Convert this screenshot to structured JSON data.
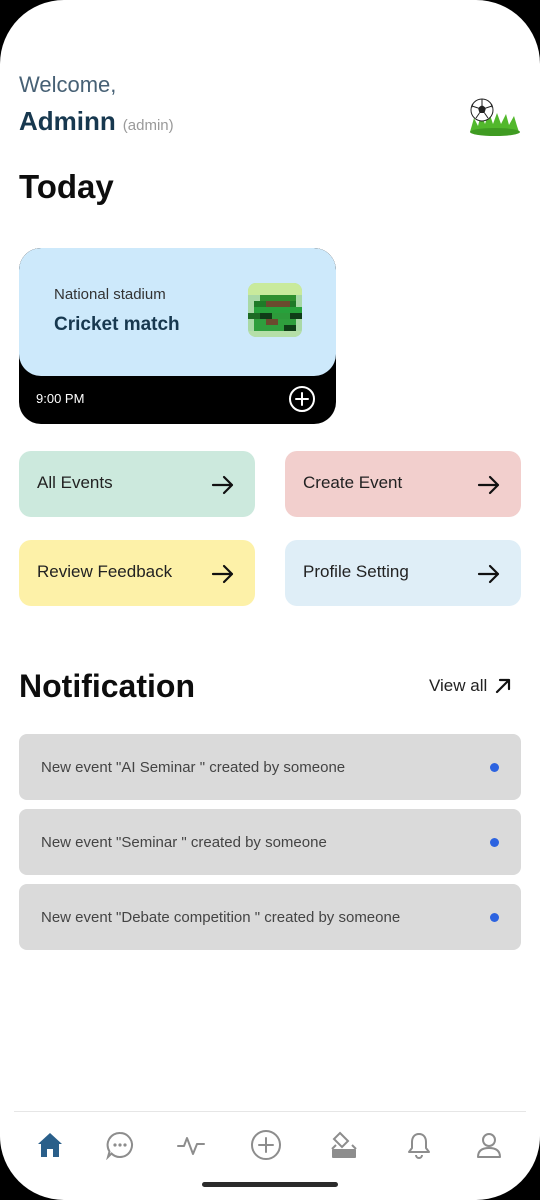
{
  "header": {
    "welcome": "Welcome,",
    "name": "Adminn",
    "role": "(admin)",
    "avatar_icon": "soccer-ball-on-grass-icon"
  },
  "today": {
    "title": "Today",
    "event": {
      "venue": "National stadium",
      "title": "Cricket match",
      "time": "9:00 PM",
      "thumbnail_icon": "pixel-art-thumbnail",
      "add_icon": "plus-circle-icon"
    }
  },
  "actions": [
    {
      "label": "All Events",
      "color": "#cce9dd",
      "icon": "arrow-right-icon"
    },
    {
      "label": "Create Event",
      "color": "#f2cfcd",
      "icon": "arrow-right-icon"
    },
    {
      "label": "Review Feedback",
      "color": "#fdf1a8",
      "icon": "arrow-right-icon"
    },
    {
      "label": "Profile Setting",
      "color": "#dfeef7",
      "icon": "arrow-right-icon"
    }
  ],
  "notifications": {
    "title": "Notification",
    "view_all": "View all",
    "items": [
      {
        "text": "New event \"AI Seminar \" created by someone",
        "unread": true
      },
      {
        "text": "New event \"Seminar \" created by someone",
        "unread": true
      },
      {
        "text": "New event \"Debate competition \" created by someone",
        "unread": true
      }
    ]
  },
  "bottom_nav": [
    "home-icon",
    "chat-icon",
    "activity-icon",
    "add-icon",
    "vote-icon",
    "bell-icon",
    "profile-icon"
  ],
  "colors": {
    "accent": "#2a5f8a",
    "unread_dot": "#2c63e0",
    "dark_text": "#17384f"
  }
}
